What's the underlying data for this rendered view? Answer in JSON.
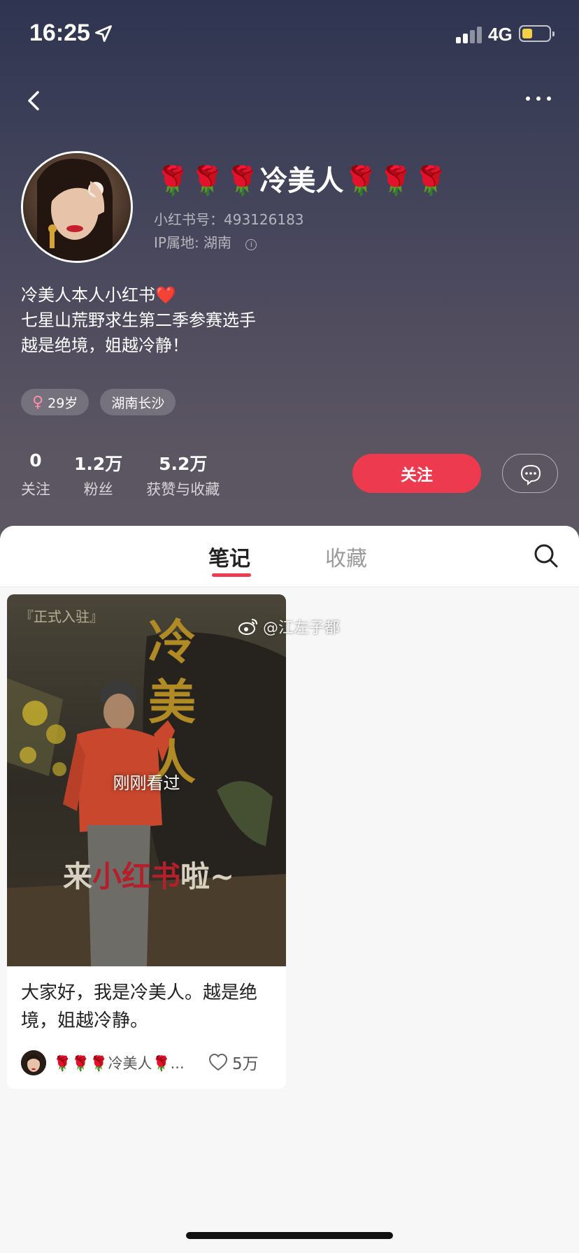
{
  "status_bar": {
    "time": "16:25",
    "network": "4G"
  },
  "profile": {
    "nickname": "🌹🌹🌹冷美人🌹🌹🌹",
    "redbook_id": "小红书号：493126183",
    "ip_location": "IP属地: 湖南",
    "bio_lines": [
      "冷美人本人小红书❤️",
      "七星山荒野求生第二季参赛选手",
      "越是绝境，姐越冷静！"
    ],
    "tags": {
      "age": "29岁",
      "location": "湖南长沙"
    },
    "stats": [
      {
        "num": "0",
        "label": "关注"
      },
      {
        "num": "1.2万",
        "label": "粉丝"
      },
      {
        "num": "5.2万",
        "label": "获赞与收藏"
      }
    ],
    "follow_label": "关注"
  },
  "tabs": {
    "notes": "笔记",
    "collect": "收藏"
  },
  "note": {
    "cover_tag": "『正式入驻』",
    "cover_big_text": [
      "冷",
      "美",
      "人"
    ],
    "cover_line_prefix": "来",
    "cover_line_highlight": "小红书",
    "cover_line_suffix": "啦~",
    "recently_viewed": "刚刚看过",
    "title": "大家好，我是冷美人。越是绝境，姐越冷静。",
    "author": "🌹🌹🌹冷美人🌹...",
    "likes": "5万"
  },
  "watermark": "@江左子都",
  "colors": {
    "accent": "#ee3a4e",
    "header_top": "#2f3450",
    "header_bottom": "#5e5863"
  },
  "icons": [
    "back-icon",
    "more-icon",
    "location-arrow-icon",
    "info-icon",
    "female-icon",
    "chat-icon",
    "search-icon",
    "heart-icon",
    "weibo-icon"
  ]
}
